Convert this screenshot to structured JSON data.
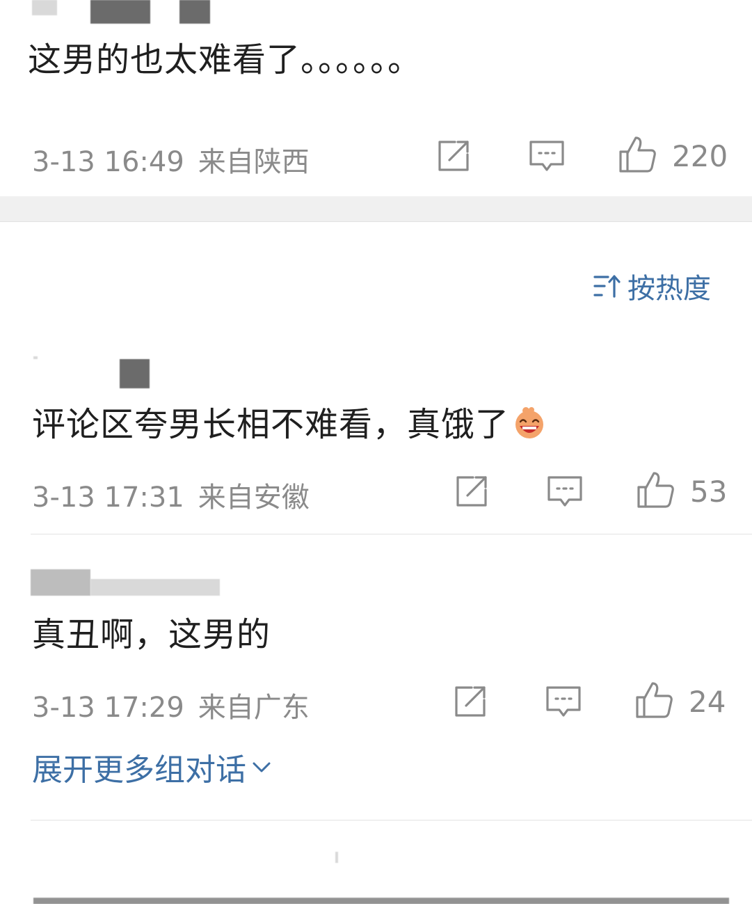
{
  "comments": [
    {
      "text": "这男的也太难看了。。。。。。",
      "date": "3-13 16:49",
      "location": "来自陕西",
      "likes": "220"
    },
    {
      "text": "评论区夸男长相不难看，真饿了",
      "date": "3-13 17:31",
      "location": "来自安徽",
      "likes": "53",
      "emoji": "laughing-face"
    },
    {
      "text": "真丑啊，这男的",
      "date": "3-13 17:29",
      "location": "来自广东",
      "likes": "24"
    }
  ],
  "sort": {
    "label": "按热度",
    "icon": "sort-icon"
  },
  "expand": {
    "label": "展开更多组对话",
    "icon": "chevron-down-icon"
  },
  "colors": {
    "link": "#3d6fa5",
    "meta": "#8a8a8a",
    "text": "#1f1f1f",
    "band": "#f0f0f0"
  }
}
